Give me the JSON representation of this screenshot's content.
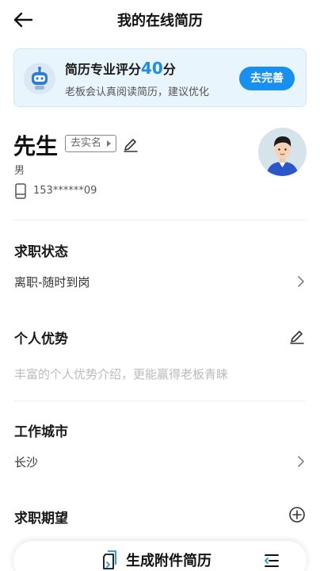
{
  "header": {
    "title": "我的在线简历"
  },
  "score_card": {
    "label_prefix": "简历专业评分",
    "score": "40",
    "label_suffix": "分",
    "subtitle": "老板会认真阅读简历，建议优化",
    "button_label": "去完善"
  },
  "profile": {
    "name": "先生",
    "realname_tag": "去实名",
    "gender": "男",
    "phone": "153******09"
  },
  "sections": {
    "job_status": {
      "title": "求职状态",
      "value": "离职-随时到岗"
    },
    "advantage": {
      "title": "个人优势",
      "placeholder": "丰富的个人优势介绍，更能赢得老板青睐"
    },
    "work_city": {
      "title": "工作城市",
      "value": "长沙"
    },
    "expectation": {
      "title": "求职期望"
    }
  },
  "bottom_bar": {
    "generate_label": "生成附件简历"
  },
  "colors": {
    "accent": "#1890ef",
    "score": "#1f8ce6",
    "card_bg": "#e9f5fc"
  },
  "icons": [
    "back-arrow-icon",
    "robot-icon",
    "edit-icon",
    "phone-icon",
    "avatar",
    "chevron-right-icon",
    "plus-circle-icon",
    "resume-icon",
    "menu-icon"
  ]
}
